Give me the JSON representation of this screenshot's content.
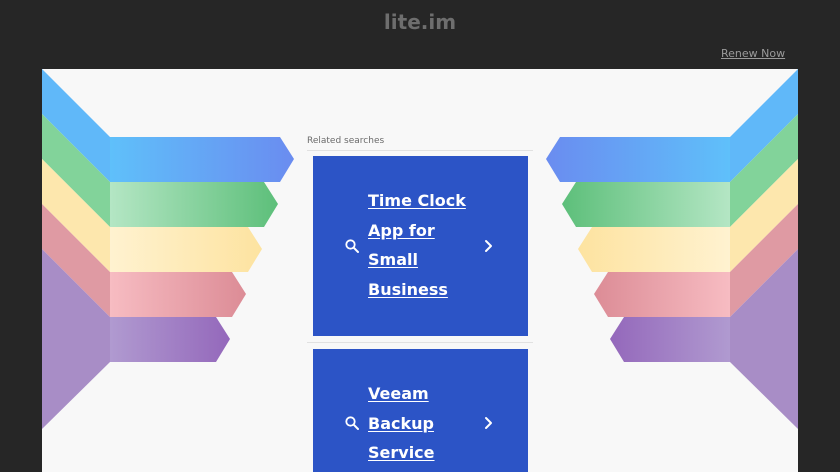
{
  "header": {
    "site_title": "lite.im",
    "renew_label": "Renew Now"
  },
  "main": {
    "related_label": "Related searches",
    "results": [
      {
        "label": "Time Clock App for Small Business",
        "icon": "search-icon",
        "arrow_icon": "chevron-right-icon"
      },
      {
        "label": "Veeam Backup Service",
        "icon": "search-icon",
        "arrow_icon": "chevron-right-icon"
      }
    ]
  },
  "colors": {
    "page_background": "#262626",
    "panel_background": "#f8f8f8",
    "card_background": "#2c54c6",
    "ribbon_blue": "#5fb7f8",
    "ribbon_green": "#6dc88a",
    "ribbon_yellow": "#fde6a6",
    "ribbon_red": "#e49aa2",
    "ribbon_purple": "#9b74bf"
  }
}
